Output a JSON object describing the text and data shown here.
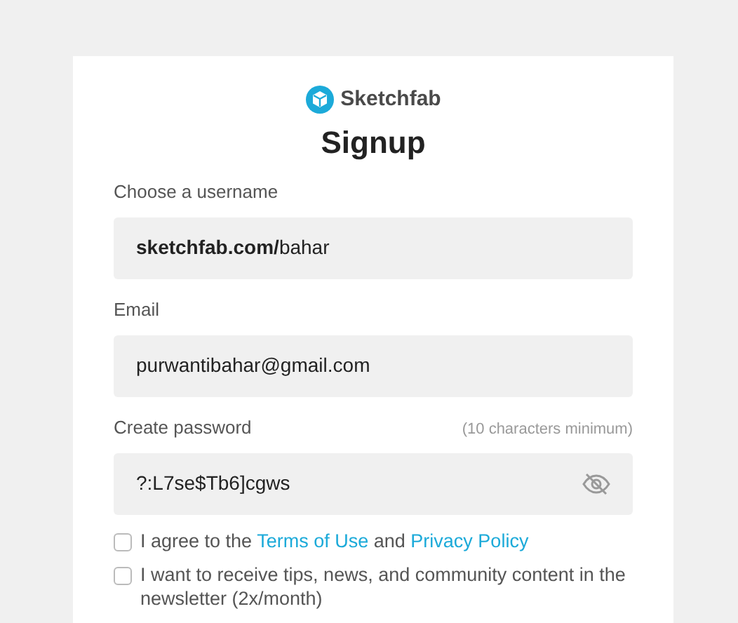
{
  "brand": {
    "name": "Sketchfab"
  },
  "title": "Signup",
  "fields": [
    {
      "kind": "username",
      "label": "Choose a username",
      "value": "**sketchfab.com/**bahar"
    },
    {
      "kind": "email",
      "label": "Email",
      "value": "purwantibahar@gmail.com"
    },
    {
      "kind": "password",
      "label": "Create password",
      "hint": "(10 characters minimum)",
      "value": "?:L7se$Tb6]cgws",
      "visible": true
    }
  ],
  "checkboxes": [
    {
      "kind": "terms",
      "checked": false,
      "before": "I agree to the",
      "link_1": "Terms of Use",
      "middle": "and",
      "link_2": "Privacy Policy"
    },
    {
      "kind": "plain",
      "checked": false,
      "text": "I want to receive tips, news, and community content in the newsletter (2x/month)"
    }
  ]
}
